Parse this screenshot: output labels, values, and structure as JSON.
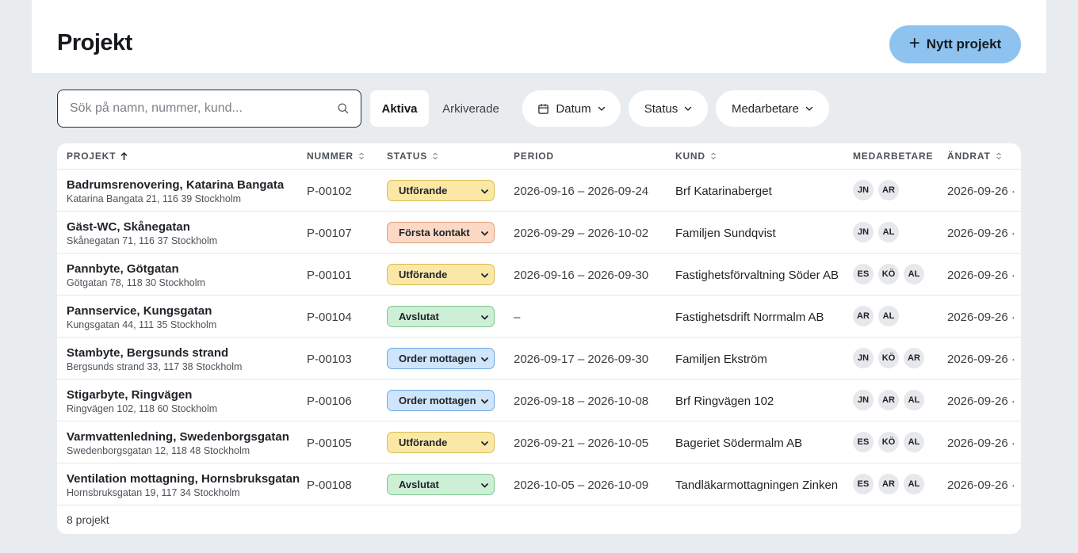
{
  "header": {
    "title": "Projekt",
    "new_button": "Nytt projekt"
  },
  "search": {
    "placeholder": "Sök på namn, nummer, kund..."
  },
  "segments": {
    "active": "Aktiva",
    "archived": "Arkiverade"
  },
  "filters": {
    "datum": "Datum",
    "status": "Status",
    "medarbetare": "Medarbetare"
  },
  "columns": {
    "projekt": "PROJEKT",
    "nummer": "NUMMER",
    "status": "STATUS",
    "period": "PERIOD",
    "kund": "KUND",
    "medarbetare": "MEDARBETARE",
    "andrat": "ÄNDRAT"
  },
  "rows": [
    {
      "name": "Badrumsrenovering, Katarina Bangata",
      "address": "Katarina Bangata 21, 116 39 Stockholm",
      "number": "P-00102",
      "status": "Utförande",
      "status_key": "utf",
      "period": "2026-09-16 – 2026-09-24",
      "customer": "Brf Katarinaberget",
      "staff": [
        "JN",
        "AR"
      ],
      "changed": "2026-09-26 ·"
    },
    {
      "name": "Gäst-WC, Skånegatan",
      "address": "Skånegatan 71, 116 37 Stockholm",
      "number": "P-00107",
      "status": "Första kontakt",
      "status_key": "forsta",
      "period": "2026-09-29 – 2026-10-02",
      "customer": "Familjen Sundqvist",
      "staff": [
        "JN",
        "AL"
      ],
      "changed": "2026-09-26 ·"
    },
    {
      "name": "Pannbyte, Götgatan",
      "address": "Götgatan 78, 118 30 Stockholm",
      "number": "P-00101",
      "status": "Utförande",
      "status_key": "utf",
      "period": "2026-09-16 – 2026-09-30",
      "customer": "Fastighetsförvaltning Söder AB",
      "staff": [
        "ES",
        "KÖ",
        "AL"
      ],
      "changed": "2026-09-26 ·"
    },
    {
      "name": "Pannservice, Kungsgatan",
      "address": "Kungsgatan 44, 111 35 Stockholm",
      "number": "P-00104",
      "status": "Avslutat",
      "status_key": "avs",
      "period": "–",
      "customer": "Fastighetsdrift Norrmalm AB",
      "staff": [
        "AR",
        "AL"
      ],
      "changed": "2026-09-26 ·"
    },
    {
      "name": "Stambyte, Bergsunds strand",
      "address": "Bergsunds strand 33, 117 38 Stockholm",
      "number": "P-00103",
      "status": "Order mottagen",
      "status_key": "order",
      "period": "2026-09-17 – 2026-09-30",
      "customer": "Familjen Ekström",
      "staff": [
        "JN",
        "KÖ",
        "AR"
      ],
      "changed": "2026-09-26 ·"
    },
    {
      "name": "Stigarbyte, Ringvägen",
      "address": "Ringvägen 102, 118 60 Stockholm",
      "number": "P-00106",
      "status": "Order mottagen",
      "status_key": "order",
      "period": "2026-09-18 – 2026-10-08",
      "customer": "Brf Ringvägen 102",
      "staff": [
        "JN",
        "AR",
        "AL"
      ],
      "changed": "2026-09-26 ·"
    },
    {
      "name": "Varmvattenledning, Swedenborgsgatan",
      "address": "Swedenborgsgatan 12, 118 48 Stockholm",
      "number": "P-00105",
      "status": "Utförande",
      "status_key": "utf",
      "period": "2026-09-21 – 2026-10-05",
      "customer": "Bageriet Södermalm AB",
      "staff": [
        "ES",
        "KÖ",
        "AL"
      ],
      "changed": "2026-09-26 ·"
    },
    {
      "name": "Ventilation mottagning, Hornsbruksgatan",
      "address": "Hornsbruksgatan 19, 117 34 Stockholm",
      "number": "P-00108",
      "status": "Avslutat",
      "status_key": "avs",
      "period": "2026-10-05 – 2026-10-09",
      "customer": "Tandläkarmottagningen Zinken",
      "staff": [
        "ES",
        "AR",
        "AL"
      ],
      "changed": "2026-09-26 ·"
    }
  ],
  "footer": {
    "count": "8 projekt"
  },
  "colors": {
    "accent": "#8ec3f0",
    "background": "#e8ecef"
  },
  "icons": {
    "search": "search-icon",
    "calendar": "calendar-icon",
    "chevron": "chevron-down-icon",
    "sort": "sort-icon",
    "plus": "plus-icon"
  }
}
